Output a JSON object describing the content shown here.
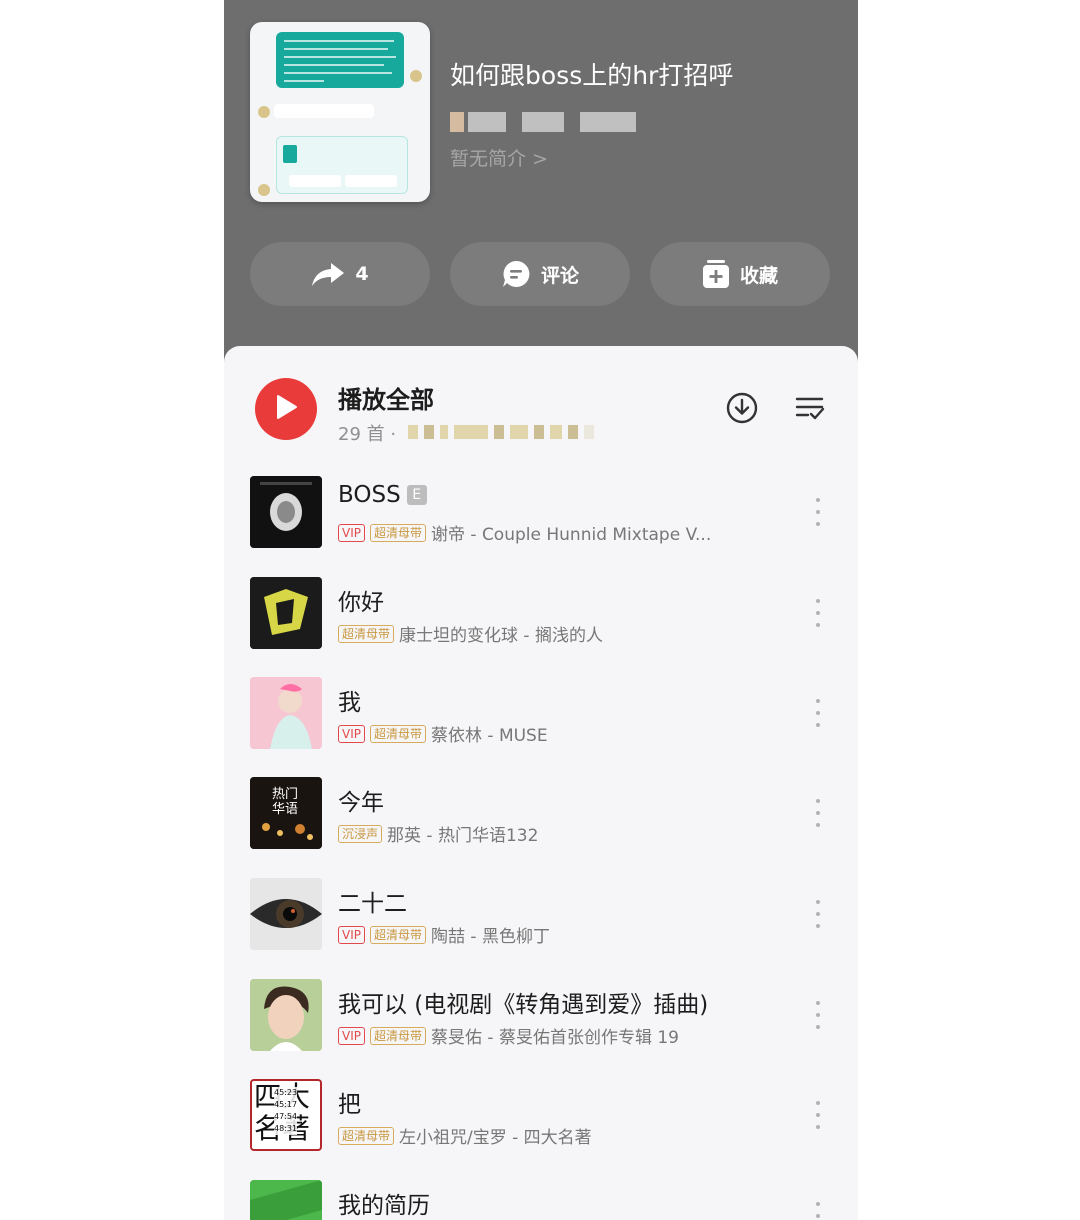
{
  "header": {
    "title": "如何跟boss上的hr打招呼",
    "intro": "暂无简介 >",
    "actions": {
      "share_count": "4",
      "comment_label": "评论",
      "collect_label": "收藏"
    }
  },
  "play_all": {
    "label": "播放全部",
    "count": "29 首 ·"
  },
  "songs": [
    {
      "title": "BOSS",
      "explicit": "E",
      "tags": [
        "VIP",
        "超清母带"
      ],
      "meta": "谢帝 - Couple Hunnid Mixtape V..."
    },
    {
      "title": "你好",
      "tags": [
        "超清母带"
      ],
      "meta": "康士坦的变化球 - 搁浅的人"
    },
    {
      "title": "我",
      "tags": [
        "VIP",
        "超清母带"
      ],
      "meta": "蔡依林 - MUSE"
    },
    {
      "title": "今年",
      "tags": [
        "沉浸声"
      ],
      "meta": "那英 - 热门华语132"
    },
    {
      "title": "二十二",
      "tags": [
        "VIP",
        "超清母带"
      ],
      "meta": "陶喆 - 黑色柳丁"
    },
    {
      "title": "我可以 (电视剧《转角遇到爱》插曲)",
      "tags": [
        "VIP",
        "超清母带"
      ],
      "meta": "蔡旻佑 - 蔡旻佑首张创作专辑 19"
    },
    {
      "title": "把",
      "tags": [
        "超清母带"
      ],
      "meta": "左小祖咒/宝罗 - 四大名著"
    },
    {
      "title": "我的简历"
    }
  ],
  "album_art_text": {
    "jinnian": "热门\n华语",
    "sida": [
      "四",
      "大",
      "名",
      "著"
    ],
    "sida_times": [
      "45:23",
      "45:17",
      "47:54",
      "48:31"
    ]
  },
  "colors": {
    "header_bg": "#6e6e6e",
    "play_red": "#ea3b3b",
    "vip_red": "#e2494b",
    "gold": "#c9973f"
  }
}
